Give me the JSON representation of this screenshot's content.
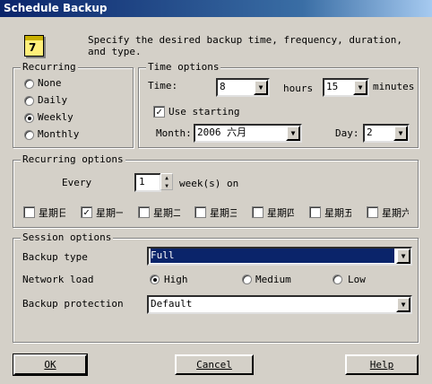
{
  "window": {
    "title": "Schedule Backup"
  },
  "intro": {
    "icon": "calendar-icon",
    "text_line1": "Specify the desired backup time, frequency, duration,",
    "text_line2": "and type."
  },
  "recurring": {
    "label": "Recurring",
    "options": [
      "None",
      "Daily",
      "Weekly",
      "Monthly"
    ],
    "selected": "Weekly"
  },
  "time_options": {
    "label": "Time options",
    "time_label": "Time:",
    "hours_value": "8",
    "hours_label": "hours",
    "minutes_value": "15",
    "minutes_label": "minutes",
    "use_starting_label": "Use starting",
    "use_starting_checked": true,
    "month_label": "Month:",
    "month_value": "2006 六月",
    "day_label": "Day:",
    "day_value": "2"
  },
  "recurring_options": {
    "label": "Recurring options",
    "every_label": "Every",
    "every_value": "1",
    "weeks_on_label": "week(s) on",
    "days": [
      {
        "label": "星期日",
        "checked": false
      },
      {
        "label": "星期一",
        "checked": true
      },
      {
        "label": "星期二",
        "checked": false
      },
      {
        "label": "星期三",
        "checked": false
      },
      {
        "label": "星期四",
        "checked": false
      },
      {
        "label": "星期五",
        "checked": false
      },
      {
        "label": "星期六",
        "checked": false
      }
    ]
  },
  "session_options": {
    "label": "Session options",
    "backup_type_label": "Backup type",
    "backup_type_value": "Full",
    "network_load_label": "Network load",
    "network_options": [
      "High",
      "Medium",
      "Low"
    ],
    "network_selected": "High",
    "protection_label": "Backup protection",
    "protection_value": "Default"
  },
  "buttons": {
    "ok": "OK",
    "cancel": "Cancel",
    "help": "Help"
  }
}
